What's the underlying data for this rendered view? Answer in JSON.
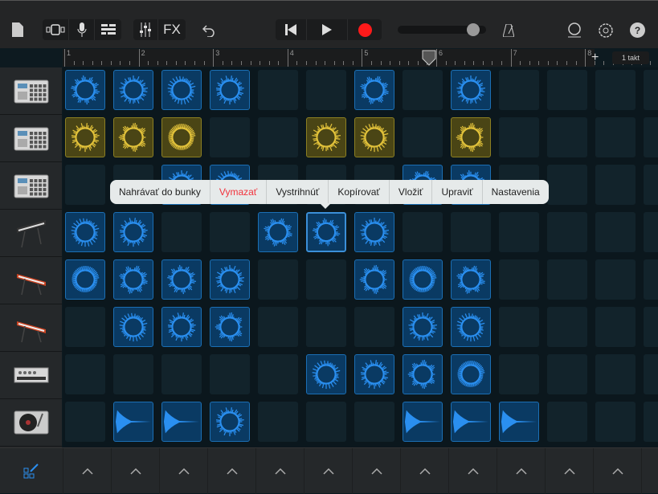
{
  "toolbar": {
    "fx_label": "FX",
    "tempo_slider": 0.85,
    "record_color": "#ff1a1a"
  },
  "ruler": {
    "bars": [
      "1",
      "2",
      "3",
      "4",
      "5",
      "6",
      "7",
      "8"
    ],
    "playhead_bar": 5.9,
    "length_label": "1 takt"
  },
  "tracks": [
    {
      "name": "drum-machine",
      "type": "drum"
    },
    {
      "name": "drum-machine",
      "type": "drum"
    },
    {
      "name": "drum-machine",
      "type": "drum"
    },
    {
      "name": "keyboard",
      "type": "keys"
    },
    {
      "name": "red-keyboard",
      "type": "redkeys"
    },
    {
      "name": "red-keyboard",
      "type": "redkeys"
    },
    {
      "name": "bass-synth",
      "type": "synth"
    },
    {
      "name": "turntable",
      "type": "turntable"
    }
  ],
  "cells": [
    {
      "row": 0,
      "cols": [
        0,
        1,
        2,
        3,
        6,
        8
      ],
      "color": "blue",
      "kind": "ring"
    },
    {
      "row": 1,
      "cols": [
        0,
        1,
        2,
        5,
        6,
        8
      ],
      "color": "yellow",
      "kind": "ring"
    },
    {
      "row": 2,
      "cols": [
        2,
        3,
        7,
        8
      ],
      "color": "blue",
      "kind": "ring"
    },
    {
      "row": 3,
      "cols": [
        0,
        1,
        4,
        5,
        6
      ],
      "color": "blue",
      "kind": "ring"
    },
    {
      "row": 4,
      "cols": [
        0,
        1,
        2,
        3,
        6,
        7,
        8
      ],
      "color": "blue",
      "kind": "ring"
    },
    {
      "row": 5,
      "cols": [
        1,
        2,
        3,
        7,
        8
      ],
      "color": "blue",
      "kind": "ring"
    },
    {
      "row": 6,
      "cols": [
        5,
        6,
        7,
        8
      ],
      "color": "blue",
      "kind": "ring"
    },
    {
      "row": 7,
      "cols": [
        3
      ],
      "color": "blue",
      "kind": "ring"
    },
    {
      "row": 7,
      "cols": [
        1,
        2,
        7,
        8,
        9
      ],
      "color": "blue",
      "kind": "wave"
    }
  ],
  "selected": {
    "row": 3,
    "col": 5
  },
  "menu": {
    "items": [
      "Nahrávať do bunky",
      "Vymazať",
      "Vystrihnúť",
      "Kopírovať",
      "Vložiť",
      "Upraviť",
      "Nastavenia"
    ]
  }
}
